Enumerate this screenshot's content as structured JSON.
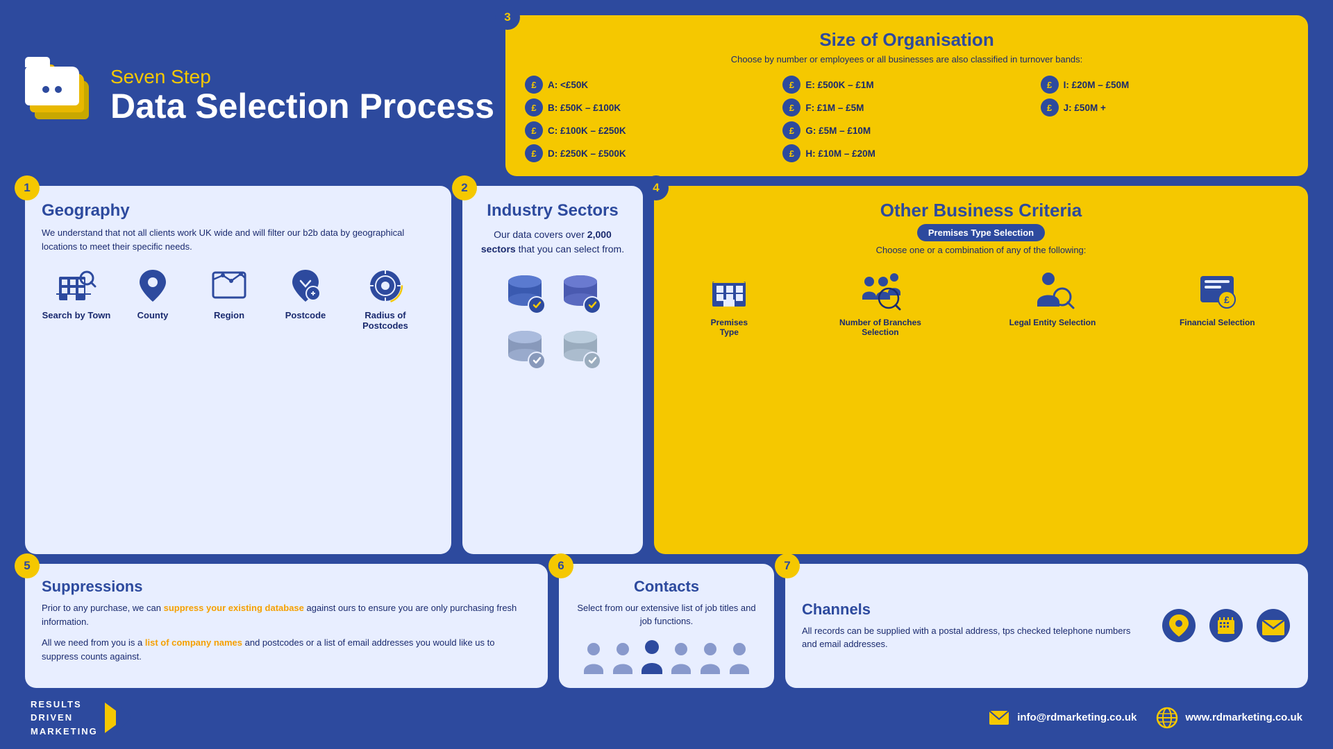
{
  "header": {
    "subtitle": "Seven Step",
    "title": "Data Selection Process",
    "step_icon": "folder"
  },
  "steps": {
    "geography": {
      "step_num": "1",
      "title": "Geography",
      "body": "We understand that not all clients work UK wide and will filter our b2b data by geographical locations to meet their specific needs.",
      "icons": [
        {
          "label": "Search by Town",
          "icon": "building"
        },
        {
          "label": "County",
          "icon": "map-pin"
        },
        {
          "label": "Region",
          "icon": "region"
        },
        {
          "label": "Postcode",
          "icon": "postcode"
        },
        {
          "label": "Radius of Postcodes",
          "icon": "radius"
        }
      ]
    },
    "industry": {
      "step_num": "2",
      "title": "Industry Sectors",
      "body_pre": "Our data covers over ",
      "body_bold": "2,000 sectors",
      "body_post": " that you can select from."
    },
    "size": {
      "step_num": "3",
      "title": "Size of Organisation",
      "subtitle": "Choose by number or employees or all businesses are also classified in turnover bands:",
      "bands": [
        {
          "label": "A: <£50K"
        },
        {
          "label": "E: £500K – £1M"
        },
        {
          "label": "I: £20M – £50M"
        },
        {
          "label": "B: £50K – £100K"
        },
        {
          "label": "F: £1M – £5M"
        },
        {
          "label": "J: £50M +"
        },
        {
          "label": "C: £100K – £250K"
        },
        {
          "label": "G: £5M – £10M"
        },
        {
          "label": ""
        },
        {
          "label": "D: £250K – £500K"
        },
        {
          "label": "H: £10M – £20M"
        },
        {
          "label": ""
        }
      ]
    },
    "criteria": {
      "step_num": "4",
      "title": "Other Business Criteria",
      "premises_badge": "Premises Type Selection",
      "choose_text": "Choose one or a combination of any of the following:",
      "items": [
        {
          "label": "Premises\nType",
          "icon": "building-icon"
        },
        {
          "label": "Number of Branches Selection",
          "icon": "branches-icon"
        },
        {
          "label": "Legal Entity Selection",
          "icon": "legal-icon"
        },
        {
          "label": "Financial Selection",
          "icon": "financial-icon"
        }
      ]
    },
    "suppressions": {
      "step_num": "5",
      "title": "Suppressions",
      "body1": "Prior to any purchase, we can ",
      "body1_link": "suppress your existing database",
      "body1_end": " against ours to ensure you are only purchasing fresh information.",
      "body2_pre": "All we need from you is a ",
      "body2_link": "list of company names",
      "body2_post": " and postcodes or a list of email addresses you would like us to suppress counts against."
    },
    "contacts": {
      "step_num": "6",
      "title": "Contacts",
      "body": "Select from our extensive list of job titles and job functions."
    },
    "channels": {
      "step_num": "7",
      "title": "Channels",
      "body": "All records can be supplied with a postal address, tps checked telephone numbers and email addresses."
    }
  },
  "footer": {
    "logo_line1": "RESULTS",
    "logo_line2": "DRIVEN",
    "logo_line3": "MARKETING",
    "email": "info@rdmarketing.co.uk",
    "website": "www.rdmarketing.co.uk"
  }
}
